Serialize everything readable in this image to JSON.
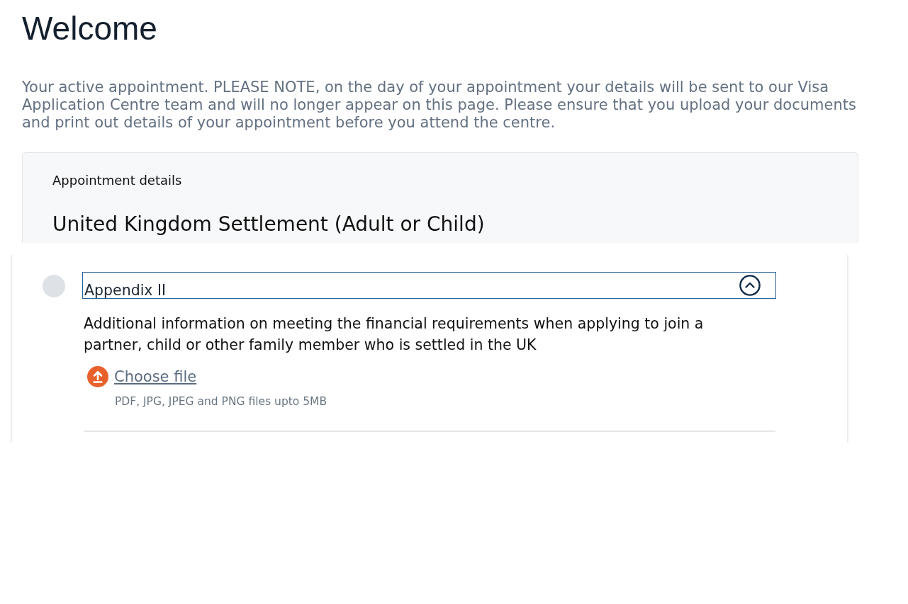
{
  "page": {
    "title": "Welcome",
    "intro": "Your active appointment. PLEASE NOTE, on the day of your appointment your details will be sent to our Visa Application Centre team and will no longer appear on this page. Please ensure that you upload your documents and print out details of your appointment before you attend the centre."
  },
  "appointment_card": {
    "label": "Appointment details",
    "title": "United Kingdom Settlement (Adult or Child)"
  },
  "documents": [
    {
      "title": "Appendix II",
      "expanded": true,
      "completed": false,
      "description": "Additional information on meeting the financial requirements when applying to join a partner, child or other family member who is settled in the UK",
      "upload": {
        "link": "Choose file",
        "hint": "PDF, JPG, JPEG and PNG files upto 5MB"
      }
    }
  ]
}
